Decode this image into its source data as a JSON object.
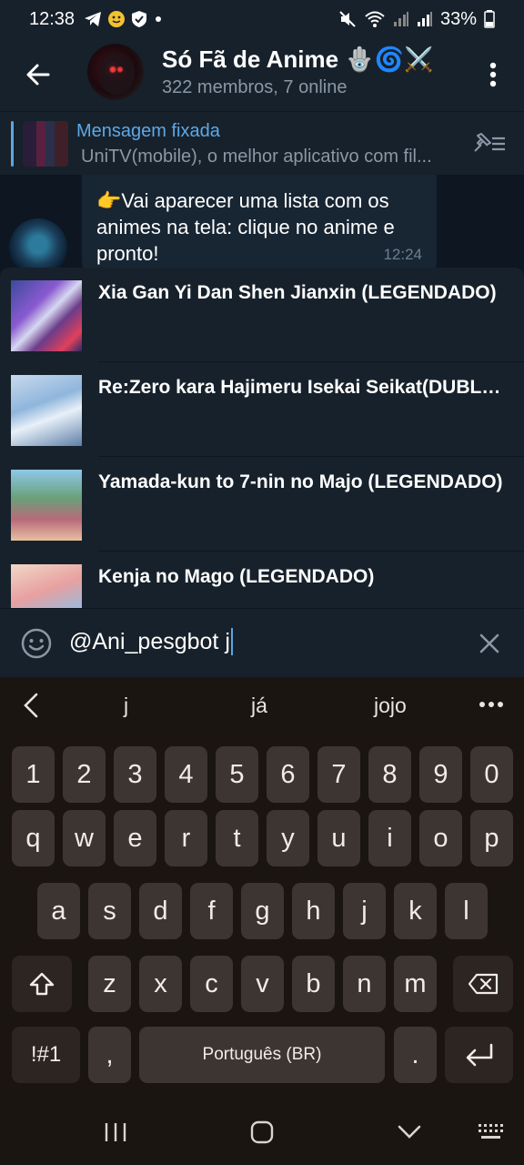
{
  "status": {
    "time": "12:38",
    "battery": "33%",
    "icons_left": [
      "telegram-icon",
      "emoji-face-icon",
      "shield-icon",
      "dot-icon"
    ],
    "icons_right": [
      "mute-icon",
      "wifi-icon",
      "signal-icon",
      "signal-icon",
      "battery-icon"
    ]
  },
  "header": {
    "title": "Só Fã de Anime 🪬🌀⚔️",
    "subtitle": "322 membros, 7 online"
  },
  "pinned": {
    "label": "Mensagem fixada",
    "text": "UniTV(mobile), o melhor aplicativo com fil..."
  },
  "message": {
    "text": "👉Vai aparecer uma lista com os animes na tela: clique no anime e pronto!",
    "time": "12:24"
  },
  "results": [
    {
      "title": "Xia Gan Yi Dan Shen Jianxin (LEGENDADO)"
    },
    {
      "title": "Re:Zero kara Hajimeru Isekai Seikat(DUBLADO)"
    },
    {
      "title": "Yamada-kun to 7-nin no Majo (LEGENDADO)"
    },
    {
      "title": "Kenja no Mago (LEGENDADO)"
    }
  ],
  "input": {
    "value": "@Ani_pesgbot j"
  },
  "keyboard": {
    "suggestions": [
      "j",
      "já",
      "jojo"
    ],
    "row_numbers": [
      "1",
      "2",
      "3",
      "4",
      "5",
      "6",
      "7",
      "8",
      "9",
      "0"
    ],
    "row1": [
      "q",
      "w",
      "e",
      "r",
      "t",
      "y",
      "u",
      "i",
      "o",
      "p"
    ],
    "row2": [
      "a",
      "s",
      "d",
      "f",
      "g",
      "h",
      "j",
      "k",
      "l"
    ],
    "row3": [
      "z",
      "x",
      "c",
      "v",
      "b",
      "n",
      "m"
    ],
    "symbols_key": "!#1",
    "comma_key": ",",
    "space_key": "Português (BR)",
    "period_key": "."
  },
  "colors": {
    "header_bg": "#17212b",
    "chat_bg": "#0e1621",
    "accent": "#5ea8e6",
    "keyboard_bg": "#1b1512",
    "key_bg": "#3d3531"
  }
}
